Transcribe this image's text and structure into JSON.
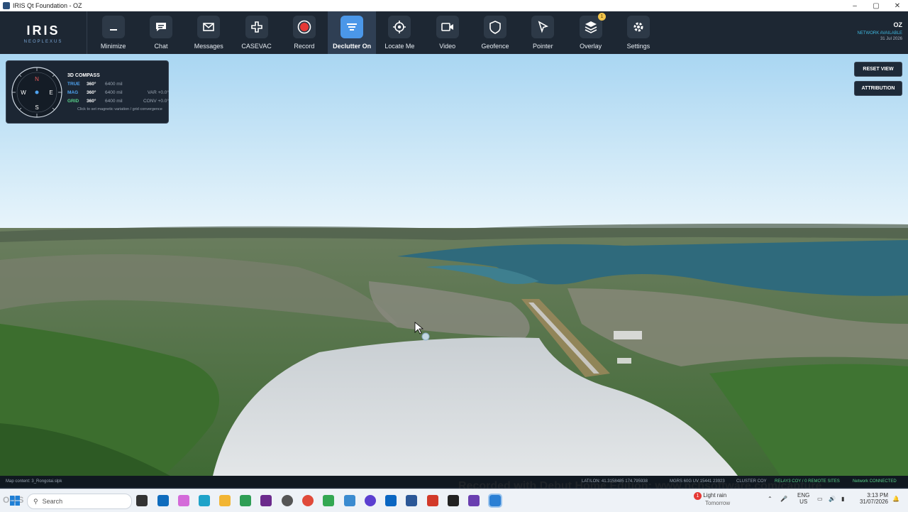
{
  "window": {
    "title": "IRIS Qt Foundation - OZ",
    "controls": [
      "–",
      "▢",
      "✕"
    ]
  },
  "brand": {
    "name": "IRIS",
    "sub": "NEOPLEXUS"
  },
  "toolbar": {
    "tools": [
      {
        "label": "Minimize",
        "icon": "minus-icon"
      },
      {
        "label": "Chat",
        "icon": "chat-icon"
      },
      {
        "label": "Messages",
        "icon": "mail-icon"
      },
      {
        "label": "CASEVAC",
        "icon": "medical-cross-icon"
      },
      {
        "label": "Record",
        "icon": "record-icon"
      },
      {
        "label": "Declutter On",
        "icon": "declutter-icon",
        "active": true
      },
      {
        "label": "Locate Me",
        "icon": "crosshair-icon"
      },
      {
        "label": "Video",
        "icon": "video-icon"
      },
      {
        "label": "Geofence",
        "icon": "geofence-icon"
      },
      {
        "label": "Pointer",
        "icon": "pointer-icon"
      },
      {
        "label": "Overlay",
        "icon": "layers-icon",
        "badge": "1"
      },
      {
        "label": "Settings",
        "icon": "gear-icon"
      }
    ]
  },
  "user": {
    "callsign": "OZ",
    "network": "NETWORK AVAILABLE",
    "date": "31 Jul 2026"
  },
  "compass": {
    "title": "3D COMPASS",
    "rows": [
      {
        "key": "TRUE",
        "value": "360°",
        "mils": "6400 mil",
        "extra": "",
        "color": "#4fa3f0"
      },
      {
        "key": "MAG",
        "value": "360°",
        "mils": "6400 mil",
        "extra": "VAR +0.0°",
        "color": "#4fa3f0"
      },
      {
        "key": "GRID",
        "value": "360°",
        "mils": "6400 mil",
        "extra": "CONV +0.0°",
        "color": "#58d08a"
      }
    ],
    "hint": "Click to set magnetic variation / grid convergence",
    "cardinals": {
      "n": "N",
      "e": "E",
      "s": "S",
      "w": "W"
    }
  },
  "map_buttons": {
    "reset": "RESET VIEW",
    "attribution": "ATTRIBUTION"
  },
  "status": {
    "file": "Map content: 3_Rongotai.slpk",
    "latlon": "LAT/LON: 41.3158485 174.795938",
    "mgrs": "MGRS  60G UV 15441 23923",
    "cluster": "CLUSTER  COY",
    "relay": "RELAY3  COY  /  0 REMOTE SITES",
    "network": "Network CONNECTED"
  },
  "watermark": "Recorded with Debut Home Edition: www.nchsoftware.com/capture",
  "taskbar": {
    "search_placeholder": "Search",
    "weather_title": "Light rain",
    "weather_sub": "Tomorrow",
    "weather_badge": "1",
    "lang1": "ENG",
    "lang2": "US",
    "time": "3:13 PM",
    "date": "31/07/2026",
    "ghost_text": "OH S"
  },
  "colors": {
    "toolbar_bg": "#1d2733",
    "active": "#4b97e8",
    "record": "#e53935",
    "badge": "#f2c44b"
  }
}
